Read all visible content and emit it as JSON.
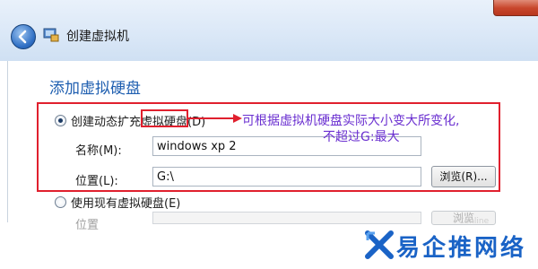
{
  "window": {
    "title": "创建虚拟机"
  },
  "heading": "添加虚拟硬盘",
  "options": {
    "dynamic": {
      "label": "创建动态扩充虚拟硬盘(D)",
      "selected": true
    },
    "existing": {
      "label": "使用现有虚拟硬盘(E)",
      "selected": false
    }
  },
  "form": {
    "name_label": "名称(M):",
    "name_value": "windows xp 2",
    "location_label": "位置(L):",
    "location_value": "G:\\",
    "browse_label": "浏览(R)...",
    "existing_location_label": "位置",
    "existing_browse_label": "浏览"
  },
  "annotation": {
    "line1": "可根据虚拟机硬盘实际大小变大所变化,",
    "line2": "不超过G:最大",
    "color": "#e0202e",
    "text_color": "#6a2fd0"
  },
  "watermark": {
    "text": "易企推网络",
    "color": "#1a63c6",
    "faint": "PConline"
  }
}
